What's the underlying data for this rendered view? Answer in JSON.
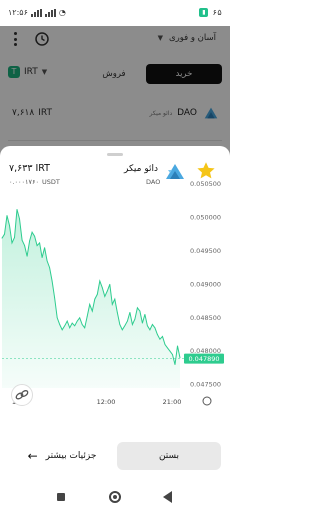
{
  "status_bar": {
    "time": "۱۲:۵۶",
    "battery": "۶۵"
  },
  "header": {
    "mode_label": "آسان و فوری"
  },
  "trade": {
    "currency": "IRT",
    "sell_tab": "فروش",
    "buy_tab": "خرید"
  },
  "pair": {
    "price": "۷,۶۱۸",
    "currency": "IRT",
    "symbol": "DAO",
    "name_small": "دائو میکر"
  },
  "sheet": {
    "price": "۷,۶۳۳",
    "price_currency": "IRT",
    "usdt_price": "۰.۰۰۰۱۷۶۰",
    "usdt_label": "USDT",
    "name": "دائو میکر",
    "symbol": "DAO",
    "close_button": "بستن",
    "details_button": "جزئیات بیشتر"
  },
  "chart_data": {
    "type": "area",
    "x_ticks": [
      "16",
      "12:00",
      "21:00"
    ],
    "y_ticks": [
      "0.050500",
      "0.050000",
      "0.049500",
      "0.049000",
      "0.048500",
      "0.048000",
      "0.047500"
    ],
    "ylim": [
      0.04745,
      0.05065
    ],
    "current_value_label": "0.047890",
    "current_value": 0.04789,
    "line_color": "#2ecc8f",
    "fill_color": "#bff0dc",
    "values": [
      0.04969,
      0.04975,
      0.05003,
      0.04988,
      0.04962,
      0.0497,
      0.05012,
      0.04998,
      0.04966,
      0.04958,
      0.04942,
      0.04965,
      0.04978,
      0.04972,
      0.04958,
      0.04962,
      0.0494,
      0.04955,
      0.04935,
      0.04925,
      0.04905,
      0.0488,
      0.0485,
      0.0484,
      0.04832,
      0.04838,
      0.04845,
      0.04835,
      0.04842,
      0.04838,
      0.04845,
      0.0485,
      0.0484,
      0.04835,
      0.04852,
      0.0487,
      0.0486,
      0.04878,
      0.04885,
      0.04905,
      0.04895,
      0.04882,
      0.0489,
      0.049,
      0.0487,
      0.04878,
      0.04858,
      0.0484,
      0.04832,
      0.04838,
      0.04845,
      0.04858,
      0.0484,
      0.04848,
      0.04865,
      0.0486,
      0.04842,
      0.04855,
      0.04838,
      0.04832,
      0.0484,
      0.04835,
      0.04825,
      0.04818,
      0.04822,
      0.0481,
      0.04805,
      0.048,
      0.04795,
      0.0478,
      0.04808,
      0.0479
    ]
  },
  "colors": {
    "accent_green": "#21c08b",
    "buy_tab_bg": "#111111",
    "star": "#f5c518",
    "dao_logo": "#4aa8e0"
  }
}
